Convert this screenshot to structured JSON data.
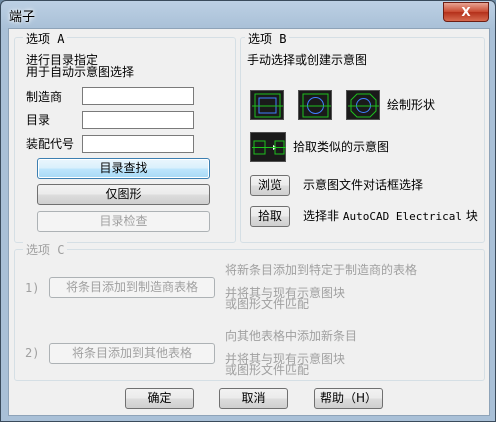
{
  "window": {
    "title": "端子",
    "close_glyph": "X"
  },
  "options_a": {
    "title": "选项 A",
    "desc_line1": "进行目录指定",
    "desc_line2": "用于自动示意图选择",
    "manufacturer_label": "制造商",
    "manufacturer_value": "",
    "catalog_label": "目录",
    "catalog_value": "",
    "assembly_label": "装配代号",
    "assembly_value": "",
    "catalog_lookup_button": "目录查找",
    "graphics_only_button": "仅图形",
    "catalog_check_button": "目录检查"
  },
  "options_b": {
    "title": "选项 B",
    "desc": "手动选择或创建示意图",
    "draw_shape_label": "绘制形状",
    "pick_similar_label": "拾取类似的示意图",
    "browse_button": "浏览",
    "browse_desc": "示意图文件对话框选择",
    "pick_button": "拾取",
    "pick_desc_prefix": "选择非",
    "pick_desc_mono": "AutoCAD Electrical",
    "pick_desc_suffix": "块",
    "icons": [
      "square-terminal-icon",
      "circle-terminal-icon",
      "octagon-terminal-icon",
      "pick-similar-icon"
    ],
    "icon_accent": "#1ec01e"
  },
  "options_c": {
    "title": "选项 C",
    "step1_num": "1)",
    "step1_button": "将条目添加到制造商表格",
    "step1_desc_line1": "将新条目添加到特定于制造商的表格",
    "step1_desc_line2": "并将其与现有示意图块",
    "step1_desc_line3": "或图形文件匹配",
    "step2_num": "2)",
    "step2_button": "将条目添加到其他表格",
    "step2_desc_line1": "向其他表格中添加新条目",
    "step2_desc_line2": "并将其与现有示意图块",
    "step2_desc_line3": "或图形文件匹配"
  },
  "footer": {
    "ok_button": "确定",
    "cancel_button": "取消",
    "help_button": "帮助（H）"
  }
}
